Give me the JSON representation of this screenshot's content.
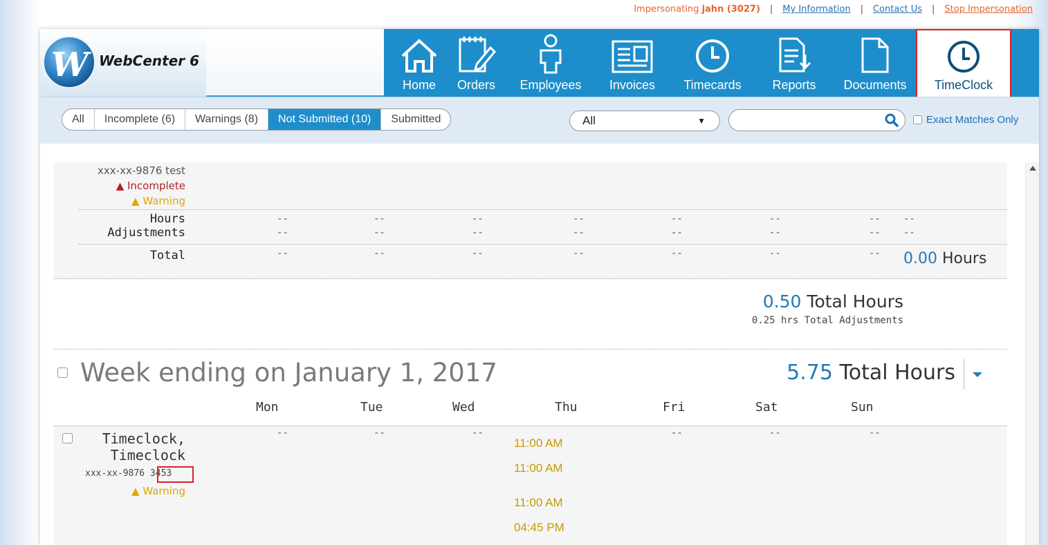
{
  "utility": {
    "impersonating_prefix": "Impersonating ",
    "impersonating_user": "jahn (3027)",
    "my_information": "My Information",
    "contact_us": "Contact Us",
    "stop_impersonation": "Stop Impersonation",
    "separator": "|"
  },
  "logo": {
    "text": "WebCenter 6",
    "mark": "W"
  },
  "nav": [
    {
      "label": "Home",
      "icon": "home-icon"
    },
    {
      "label": "Orders",
      "icon": "orders-icon"
    },
    {
      "label": "Employees",
      "icon": "employees-icon"
    },
    {
      "label": "Invoices",
      "icon": "invoices-icon"
    },
    {
      "label": "Timecards",
      "icon": "timecards-icon"
    },
    {
      "label": "Reports",
      "icon": "reports-icon"
    },
    {
      "label": "Documents",
      "icon": "documents-icon"
    },
    {
      "label": "TimeClock",
      "icon": "clock-icon",
      "active": true
    }
  ],
  "filters": {
    "segments": [
      "All",
      "Incomplete (6)",
      "Warnings (8)",
      "Not Submitted (10)",
      "Submitted"
    ],
    "active_segment": "Not Submitted (10)",
    "dropdown_value": "All",
    "dropdown_caret": "▼",
    "search_value": "",
    "exact_matches": "Exact Matches Only"
  },
  "prev_employee": {
    "ssn_line": "xxx-xx-9876 test",
    "incomplete": "Incomplete",
    "warning": "Warning",
    "hours_label": "Hours",
    "adjustments_label": "Adjustments",
    "total_label": "Total",
    "dash": "--",
    "total_value": "0.00",
    "total_unit": "Hours"
  },
  "prev_summary": {
    "total_hours_value": "0.50",
    "total_hours_label": "Total Hours",
    "adjustments_text": "0.25 hrs Total Adjustments"
  },
  "week": {
    "title": "Week ending on January 1, 2017",
    "total_value": "5.75",
    "total_label": "Total Hours",
    "days": [
      "Mon",
      "Tue",
      "Wed",
      "Thu",
      "Fri",
      "Sat",
      "Sun"
    ]
  },
  "timeclock_employee": {
    "last_name": "Timeclock,",
    "first_name": "Timeclock",
    "ssn_prefix": "xxx-xx-9876",
    "employee_id": "3453",
    "warning": "Warning",
    "dash": "--",
    "thu_times": [
      "11:00 AM",
      "11:00 AM",
      "11:00 AM",
      "04:45 PM"
    ]
  },
  "colors": {
    "nav_blue": "#1d8ecb",
    "accent_red": "#d6222b",
    "link_blue": "#1f7ab8",
    "warning_yellow": "#e0a800",
    "incomplete_red": "#b22222"
  }
}
